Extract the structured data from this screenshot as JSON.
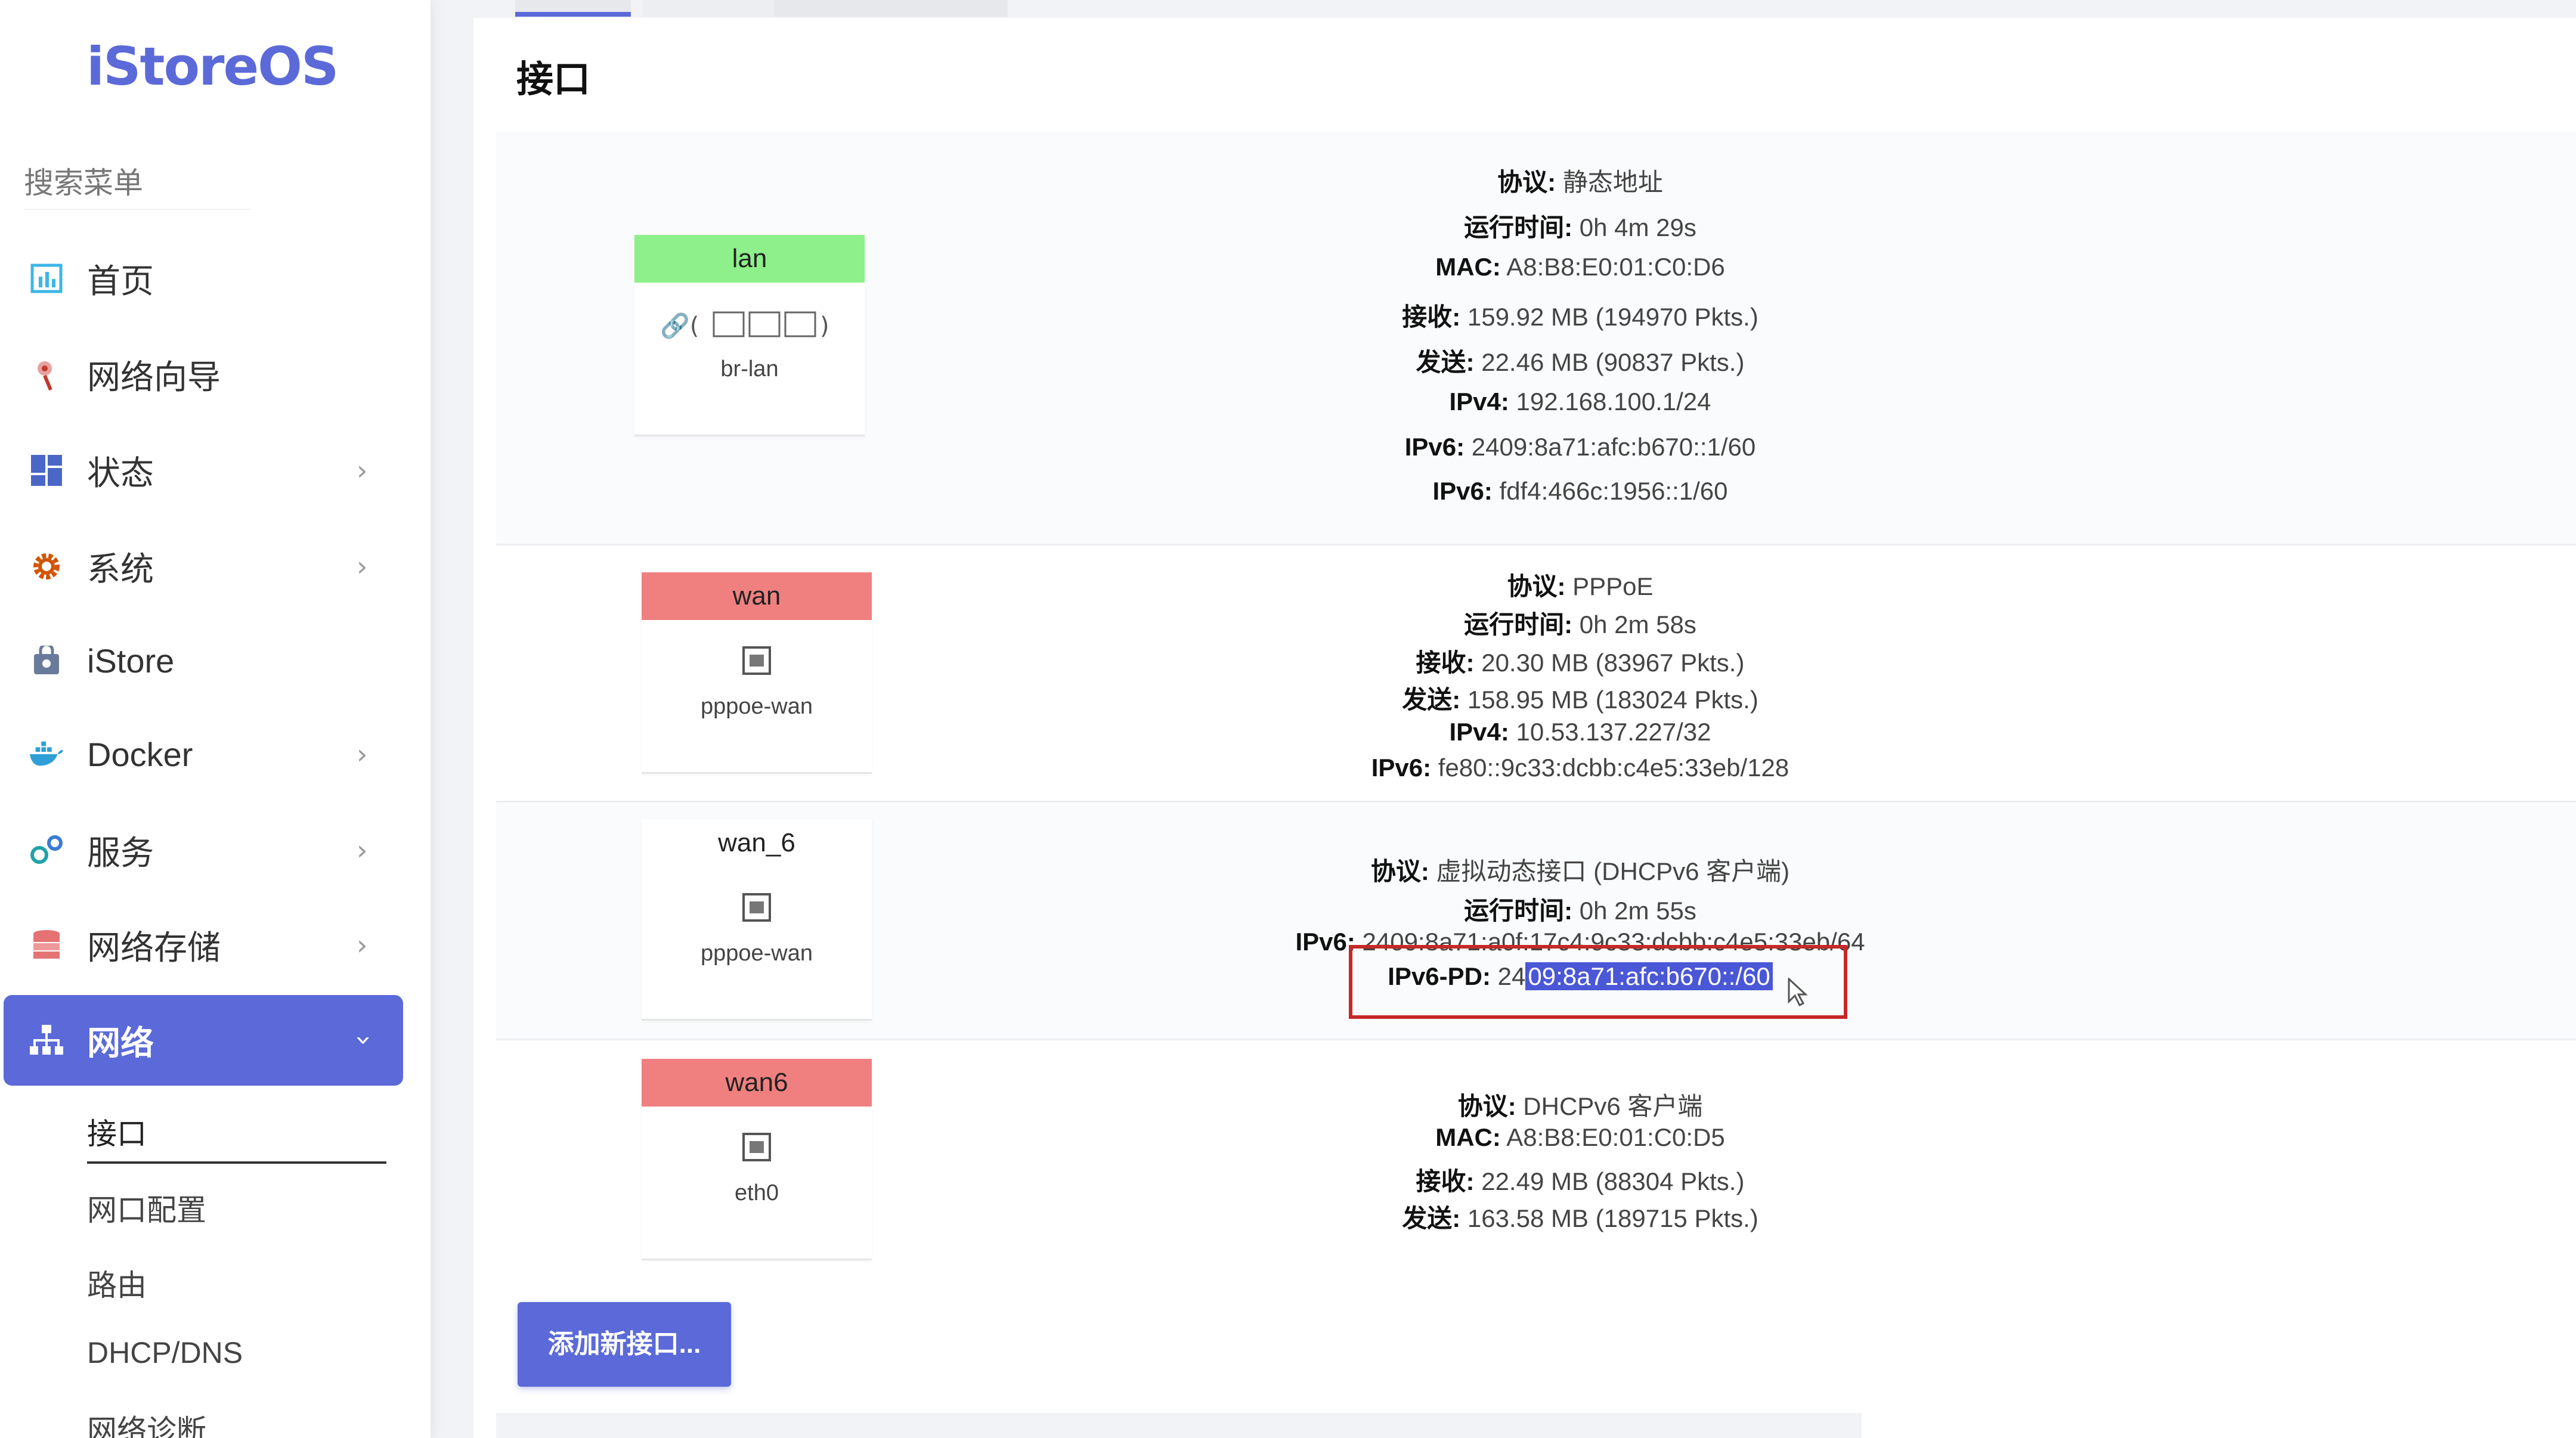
{
  "app": {
    "logo": "iStoreOS"
  },
  "sidebar": {
    "search_placeholder": "搜索菜单",
    "items": [
      {
        "label": "首页",
        "icon": "dashboard-icon",
        "chevron": false
      },
      {
        "label": "网络向导",
        "icon": "wizard-icon",
        "chevron": false
      },
      {
        "label": "状态",
        "icon": "grid-icon",
        "chevron": true
      },
      {
        "label": "系统",
        "icon": "gear-icon",
        "chevron": true
      },
      {
        "label": "iStore",
        "icon": "store-icon",
        "chevron": false
      },
      {
        "label": "Docker",
        "icon": "docker-icon",
        "chevron": true
      },
      {
        "label": "服务",
        "icon": "services-icon",
        "chevron": true
      },
      {
        "label": "网络存储",
        "icon": "storage-icon",
        "chevron": true
      },
      {
        "label": "网络",
        "icon": "network-icon",
        "chevron": true,
        "active": true
      }
    ],
    "subitems": [
      "接口",
      "网口配置",
      "路由",
      "DHCP/DNS",
      "网络诊断"
    ],
    "chevron_glyph": "›",
    "colors": {
      "accent": "#5b6ad8"
    }
  },
  "main": {
    "title": "接口",
    "interfaces": [
      {
        "name": "lan",
        "color": "#8ef08a",
        "device": "br-lan",
        "icon_text": "🔗 (🖧🖧🖧)",
        "info": [
          {
            "k": "协议:",
            "v": " 静态地址"
          },
          {
            "k": "运行时间:",
            "v": " 0h 4m 29s"
          },
          {
            "k": "MAC:",
            "v": " A8:B8:E0:01:C0:D6"
          },
          {
            "k": "接收:",
            "v": " 159.92 MB (194970 Pkts.)"
          },
          {
            "k": "发送:",
            "v": " 22.46 MB (90837 Pkts.)"
          },
          {
            "k": "IPv4:",
            "v": " 192.168.100.1/24"
          },
          {
            "k": "IPv6:",
            "v": " 2409:8a71:afc:b670::1/60"
          },
          {
            "k": "IPv6:",
            "v": " fdf4:466c:1956::1/60"
          }
        ]
      },
      {
        "name": "wan",
        "color": "#f08080",
        "device": "pppoe-wan",
        "info": [
          {
            "k": "协议:",
            "v": " PPPoE"
          },
          {
            "k": "运行时间:",
            "v": " 0h 2m 58s"
          },
          {
            "k": "接收:",
            "v": " 20.30 MB (83967 Pkts.)"
          },
          {
            "k": "发送:",
            "v": " 158.95 MB (183024 Pkts.)"
          },
          {
            "k": "IPv4:",
            "v": " 10.53.137.227/32"
          },
          {
            "k": "IPv6:",
            "v": " fe80::9c33:dcbb:c4e5:33eb/128"
          }
        ]
      },
      {
        "name": "wan_6",
        "color": "#ffffff",
        "device": "pppoe-wan",
        "info": [
          {
            "k": "协议:",
            "v": " 虚拟动态接口 (DHCPv6 客户端)"
          },
          {
            "k": "运行时间:",
            "v": " 0h 2m 55s"
          },
          {
            "k": "IPv6:",
            "v": " 2409:8a71:a0f:17c4:9c33:dcbb:c4e5:33eb/64"
          }
        ],
        "pd": {
          "k": "IPv6-PD:",
          "prefix": " 24",
          "highlight": "09:8a71:afc:b670::/60"
        }
      },
      {
        "name": "wan6",
        "color": "#f08080",
        "device": "eth0",
        "info": [
          {
            "k": "协议:",
            "v": " DHCPv6 客户端"
          },
          {
            "k": "MAC:",
            "v": " A8:B8:E0:01:C0:D5"
          },
          {
            "k": "接收:",
            "v": " 22.49 MB (88304 Pkts.)"
          },
          {
            "k": "发送:",
            "v": " 163.58 MB (189715 Pkts.)"
          }
        ]
      }
    ],
    "add_button": "添加新接口..."
  }
}
